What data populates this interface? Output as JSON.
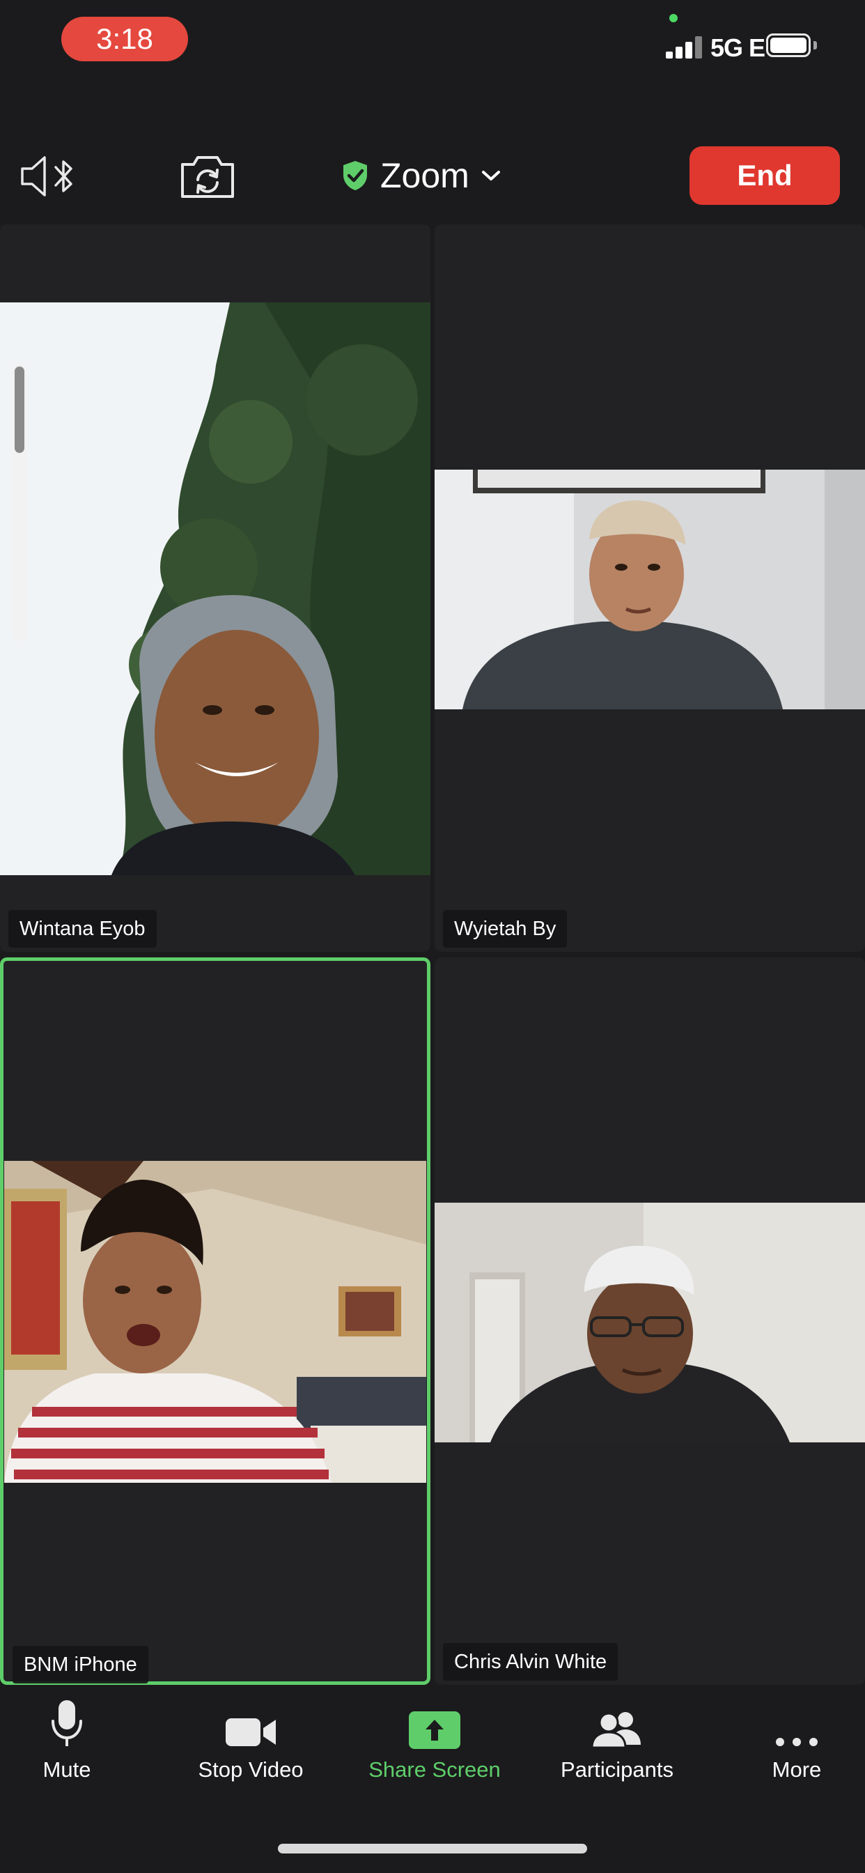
{
  "status_bar": {
    "time": "3:18",
    "network": "5G E",
    "signal_bars": 4,
    "battery_level": 0.85
  },
  "toolbar": {
    "title": "Zoom",
    "end_label": "End"
  },
  "participants": [
    {
      "name": "Wintana Eyob",
      "active_speaker": false
    },
    {
      "name": "Wyietah By",
      "active_speaker": false
    },
    {
      "name": "BNM iPhone",
      "active_speaker": true
    },
    {
      "name": "Chris Alvin White",
      "active_speaker": false
    }
  ],
  "bottom_bar": {
    "mute": "Mute",
    "stop_video": "Stop Video",
    "share_screen": "Share Screen",
    "participants": "Participants",
    "more": "More"
  },
  "colors": {
    "background": "#1b1b1d",
    "tile": "#222224",
    "end_red": "#e0382f",
    "time_pill": "#e5483e",
    "accent_green": "#5fce6a"
  }
}
